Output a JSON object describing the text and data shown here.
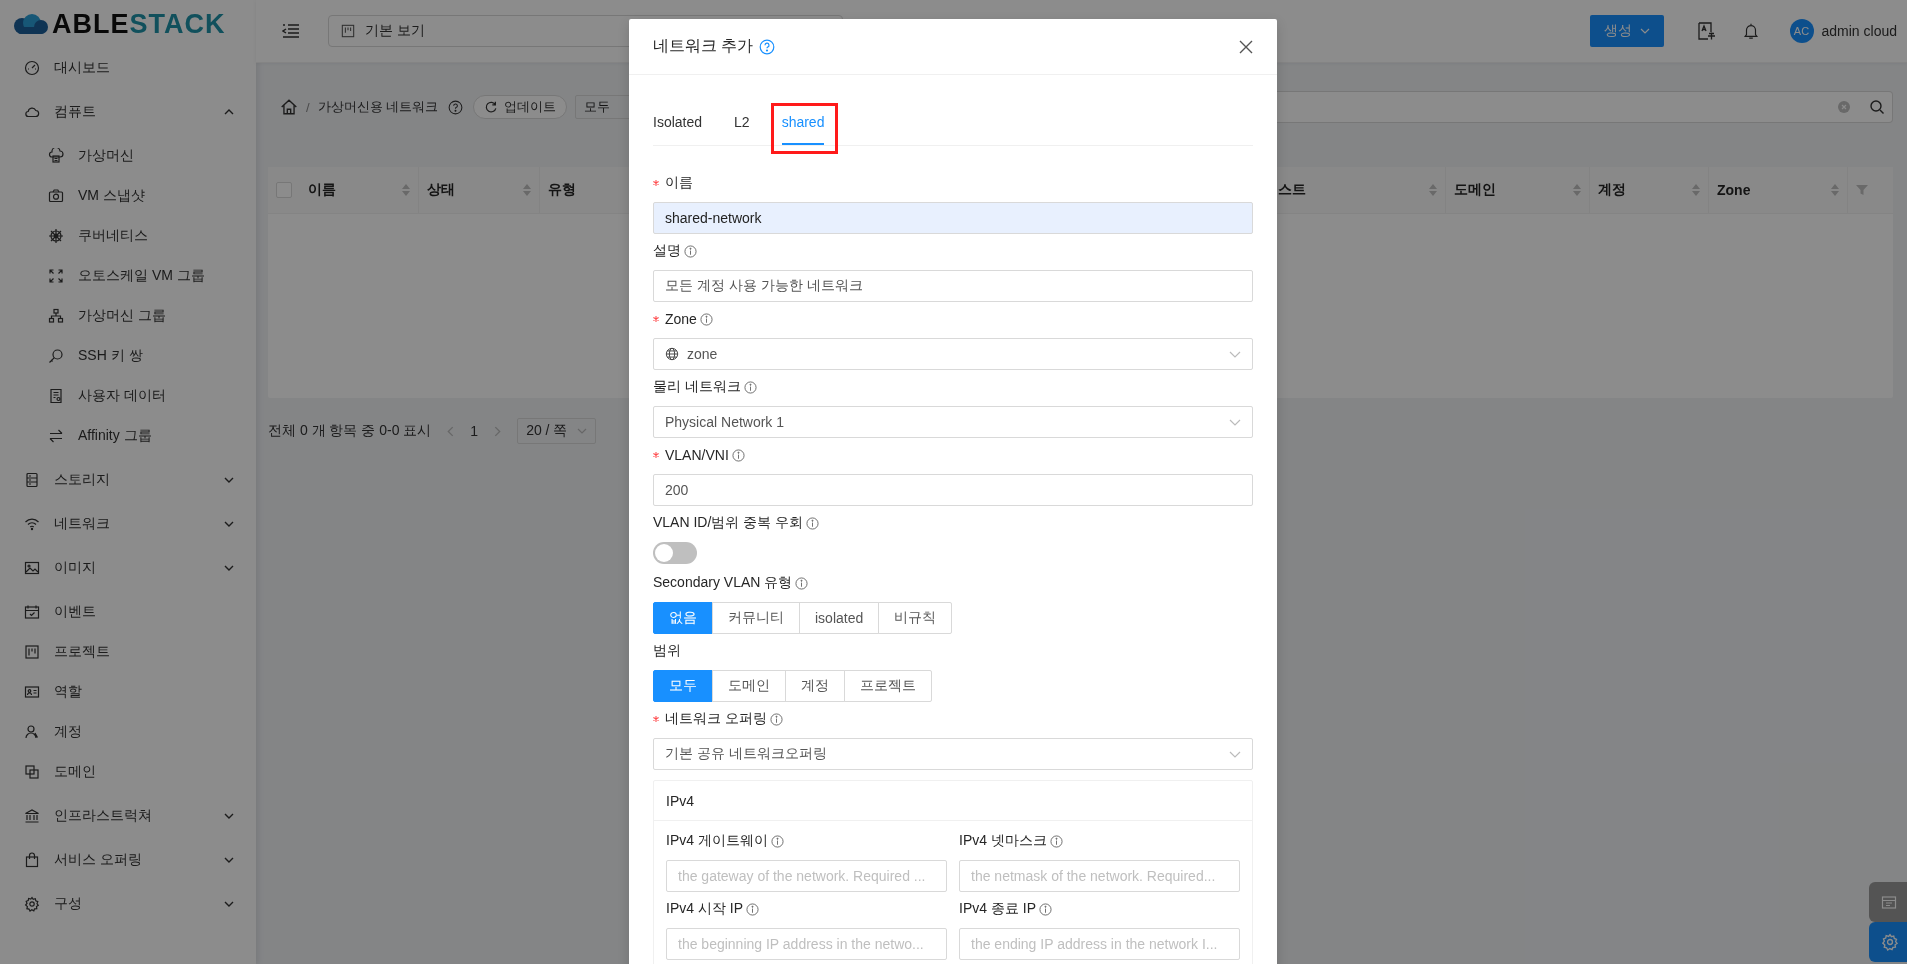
{
  "logo": [
    "ABLE",
    "STACK"
  ],
  "sidebar": {
    "items": [
      {
        "label": "대시보드"
      },
      {
        "label": "컴퓨트",
        "expanded": true,
        "children": [
          {
            "label": "가상머신"
          },
          {
            "label": "VM 스냅샷"
          },
          {
            "label": "쿠버네티스"
          },
          {
            "label": "오토스케일 VM 그룹"
          },
          {
            "label": "가상머신 그룹"
          },
          {
            "label": "SSH 키 쌍"
          },
          {
            "label": "사용자 데이터"
          },
          {
            "label": "Affinity 그룹"
          }
        ]
      },
      {
        "label": "스토리지",
        "expanded": false
      },
      {
        "label": "네트워크",
        "expanded": false
      },
      {
        "label": "이미지",
        "expanded": false
      },
      {
        "label": "이벤트"
      },
      {
        "label": "프로젝트"
      },
      {
        "label": "역할"
      },
      {
        "label": "계정"
      },
      {
        "label": "도메인"
      },
      {
        "label": "인프라스트럭쳐",
        "expanded": false
      },
      {
        "label": "서비스 오퍼링",
        "expanded": false
      },
      {
        "label": "구성",
        "expanded": false
      }
    ]
  },
  "header": {
    "view_select": "기본 보기",
    "create_button": "생성",
    "user": {
      "initials": "AC",
      "name": "admin cloud"
    }
  },
  "toolbar": {
    "separator": "/",
    "current_page": "가상머신용 네트워크",
    "refresh_button": "업데이트",
    "filter": "모두"
  },
  "table": {
    "select_all_checked": false,
    "columns": [
      "이름",
      "상태",
      "유형",
      "스트",
      "도메인",
      "계정",
      "Zone"
    ]
  },
  "pagination": {
    "summary": "전체 0 개 항목 중 0-0 표시",
    "page": "1",
    "page_size": "20 / 쪽"
  },
  "modal": {
    "title": "네트워크 추가",
    "tabs": [
      {
        "label": "Isolated",
        "selected": false,
        "highlighted": false
      },
      {
        "label": "L2",
        "selected": false,
        "highlighted": false
      },
      {
        "label": "shared",
        "selected": true,
        "highlighted": true
      }
    ],
    "fields": [
      {
        "kind": "input",
        "label": "이름",
        "required": true,
        "info": false,
        "value": "shared-network",
        "autofilled": true
      },
      {
        "kind": "input",
        "label": "설명",
        "required": false,
        "info": true,
        "value": "모든 계정 사용 가능한 네트워크",
        "autofilled": false
      },
      {
        "kind": "select",
        "label": "Zone",
        "required": true,
        "info": true,
        "value": "zone",
        "prefix_icon": true
      },
      {
        "kind": "select",
        "label": "물리 네트워크",
        "required": false,
        "info": true,
        "value": "Physical Network 1",
        "prefix_icon": false
      },
      {
        "kind": "input",
        "label": "VLAN/VNI",
        "required": true,
        "info": true,
        "value": "200",
        "autofilled": false
      },
      {
        "kind": "toggle",
        "label": "VLAN ID/범위 중복 우회",
        "required": false,
        "info": true,
        "on": false
      },
      {
        "kind": "segmented",
        "label": "Secondary VLAN 유형",
        "required": false,
        "info": true,
        "options": [
          {
            "label": "없음",
            "selected": true
          },
          {
            "label": "커뮤니티",
            "selected": false
          },
          {
            "label": "isolated",
            "selected": false
          },
          {
            "label": "비규칙",
            "selected": false
          }
        ]
      },
      {
        "kind": "segmented",
        "label": "범위",
        "required": false,
        "info": false,
        "options": [
          {
            "label": "모두",
            "selected": true
          },
          {
            "label": "도메인",
            "selected": false
          },
          {
            "label": "계정",
            "selected": false
          },
          {
            "label": "프로젝트",
            "selected": false
          }
        ]
      },
      {
        "kind": "select",
        "label": "네트워크 오퍼링",
        "required": true,
        "info": true,
        "value": "기본 공유 네트워크오퍼링",
        "prefix_icon": false
      },
      {
        "kind": "group",
        "title": "IPv4",
        "fields": [
          {
            "label": "IPv4 게이트웨이",
            "info": true,
            "placeholder": "the gateway of the network. Required ..."
          },
          {
            "label": "IPv4 넷마스크",
            "info": true,
            "placeholder": "the netmask of the network. Required..."
          },
          {
            "label": "IPv4 시작 IP",
            "info": true,
            "placeholder": "the beginning IP address in the netwo..."
          },
          {
            "label": "IPv4 종료 IP",
            "info": true,
            "placeholder": "the ending IP address in the network I..."
          }
        ]
      }
    ]
  }
}
